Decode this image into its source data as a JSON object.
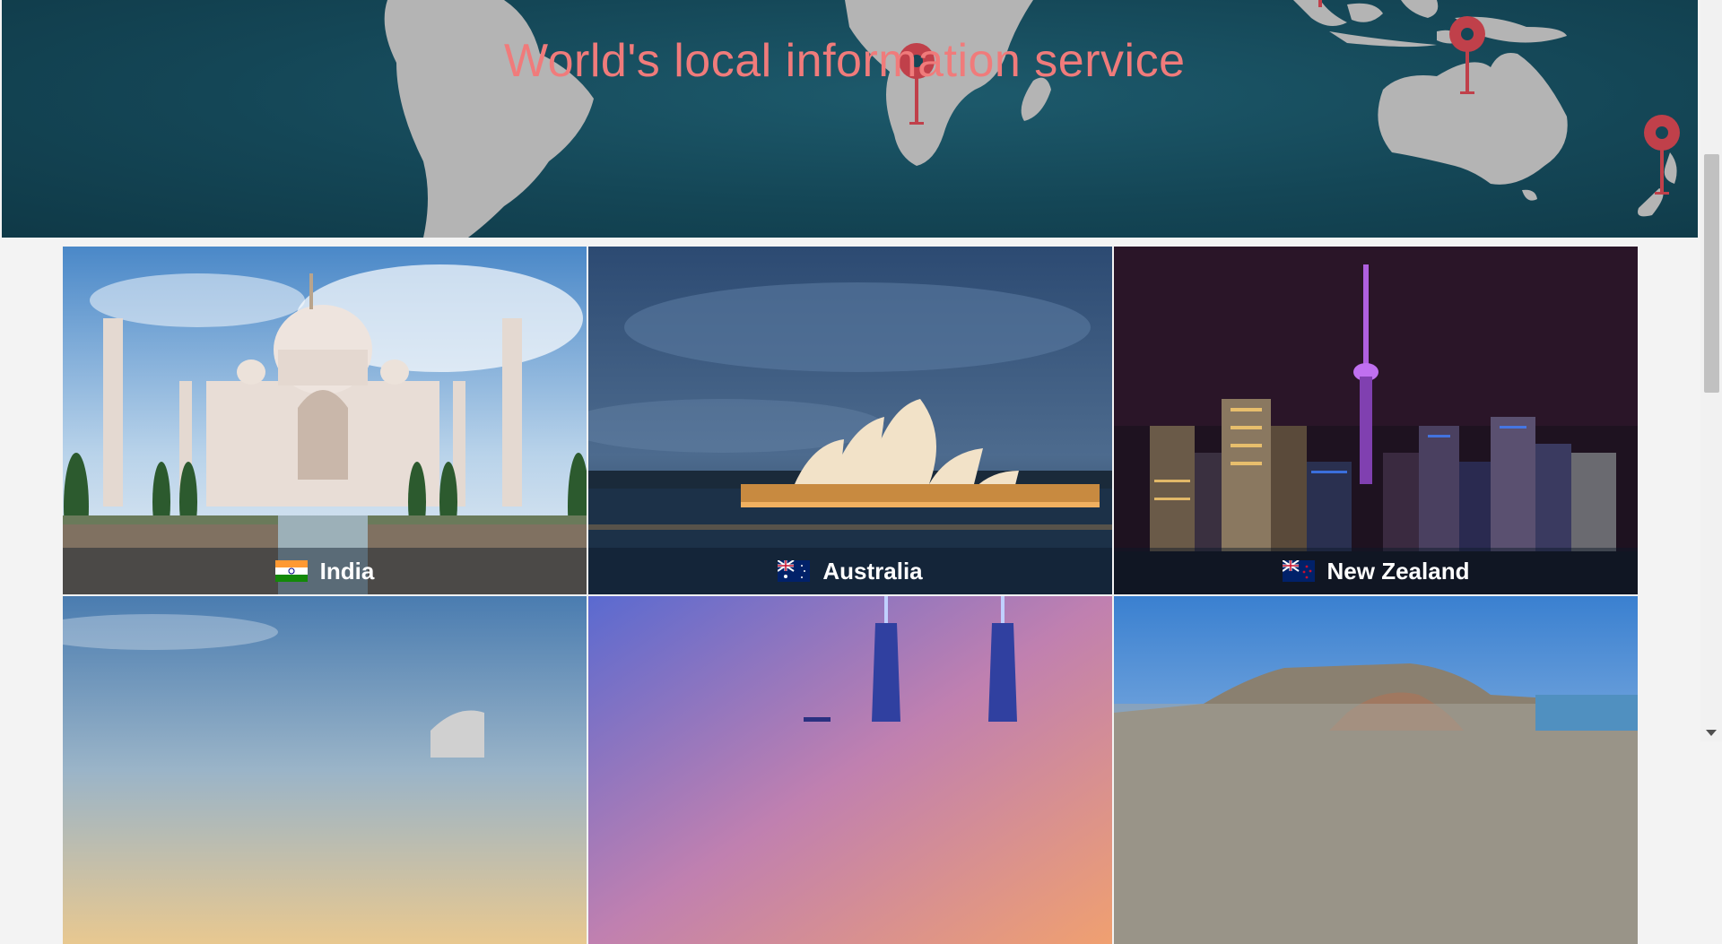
{
  "hero": {
    "title": "World's local information service"
  },
  "countries": [
    {
      "name": "India",
      "flag": "india-flag-icon"
    },
    {
      "name": "Australia",
      "flag": "australia-flag-icon"
    },
    {
      "name": "New Zealand",
      "flag": "new-zealand-flag-icon"
    },
    {
      "name": "",
      "flag": ""
    },
    {
      "name": "",
      "flag": ""
    },
    {
      "name": "",
      "flag": ""
    }
  ],
  "colors": {
    "hero_bg": "#144656",
    "hero_title": "#f07b7b",
    "pin": "#c0404a",
    "land": "#b4b4b4",
    "caption_bg": "rgba(10,25,40,0.45)"
  }
}
